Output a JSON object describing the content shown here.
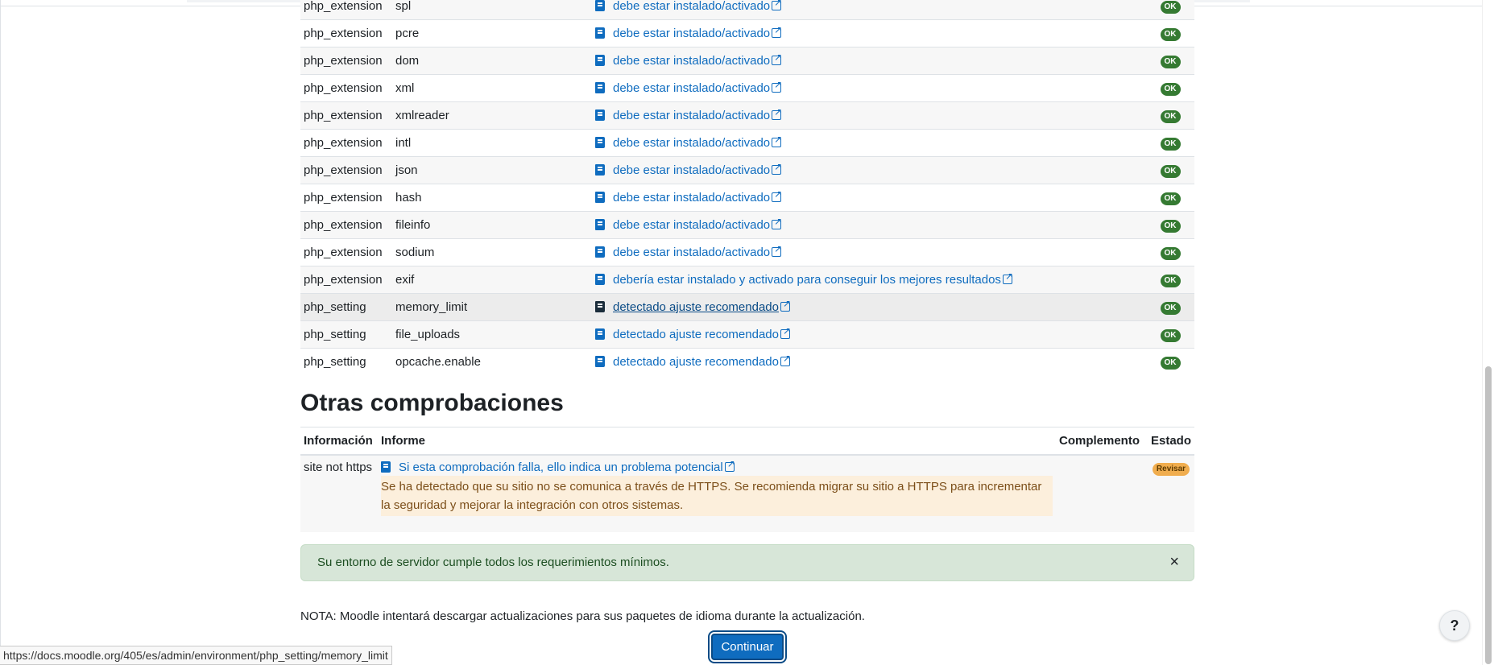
{
  "env_rows": [
    {
      "type": "php_extension",
      "name": "spl",
      "report": "debe estar instalado/activado",
      "status": "OK"
    },
    {
      "type": "php_extension",
      "name": "pcre",
      "report": "debe estar instalado/activado",
      "status": "OK"
    },
    {
      "type": "php_extension",
      "name": "dom",
      "report": "debe estar instalado/activado",
      "status": "OK"
    },
    {
      "type": "php_extension",
      "name": "xml",
      "report": "debe estar instalado/activado",
      "status": "OK"
    },
    {
      "type": "php_extension",
      "name": "xmlreader",
      "report": "debe estar instalado/activado",
      "status": "OK"
    },
    {
      "type": "php_extension",
      "name": "intl",
      "report": "debe estar instalado/activado",
      "status": "OK"
    },
    {
      "type": "php_extension",
      "name": "json",
      "report": "debe estar instalado/activado",
      "status": "OK"
    },
    {
      "type": "php_extension",
      "name": "hash",
      "report": "debe estar instalado/activado",
      "status": "OK"
    },
    {
      "type": "php_extension",
      "name": "fileinfo",
      "report": "debe estar instalado/activado",
      "status": "OK"
    },
    {
      "type": "php_extension",
      "name": "sodium",
      "report": "debe estar instalado/activado",
      "status": "OK"
    },
    {
      "type": "php_extension",
      "name": "exif",
      "report": "debería estar instalado y activado para conseguir los mejores resultados",
      "status": "OK"
    },
    {
      "type": "php_setting",
      "name": "memory_limit",
      "report": "detectado ajuste recomendado",
      "status": "OK"
    },
    {
      "type": "php_setting",
      "name": "file_uploads",
      "report": "detectado ajuste recomendado",
      "status": "OK"
    },
    {
      "type": "php_setting",
      "name": "opcache.enable",
      "report": "detectado ajuste recomendado",
      "status": "OK"
    }
  ],
  "other_checks": {
    "title": "Otras comprobaciones",
    "headers": {
      "info": "Información",
      "report": "Informe",
      "plugin": "Complemento",
      "status": "Estado"
    },
    "rows": [
      {
        "info": "site not https",
        "report": "Si esta comprobación falla, ello indica un problema potencial",
        "notice": "Se ha detectado que su sitio no se comunica a través de HTTPS. Se recomienda migrar su sitio a HTTPS para incrementar la seguridad y mejorar la integración con otros sistemas.",
        "plugin": "",
        "status": "Revisar"
      }
    ]
  },
  "alert": {
    "text": "Su entorno de servidor cumple todos los requerimientos mínimos.",
    "close": "×"
  },
  "note": "NOTA: Moodle intentará descargar actualizaciones para sus paquetes de idioma durante la actualización.",
  "continue_label": "Continuar",
  "statusbar_url": "https://docs.moodle.org/405/es/admin/environment/php_setting/memory_limit",
  "help_label": "?",
  "colors": {
    "ok": "#357a32",
    "warn": "#f0ad4e",
    "link": "#0f6cbf",
    "success_bg": "#d7e6d8"
  }
}
